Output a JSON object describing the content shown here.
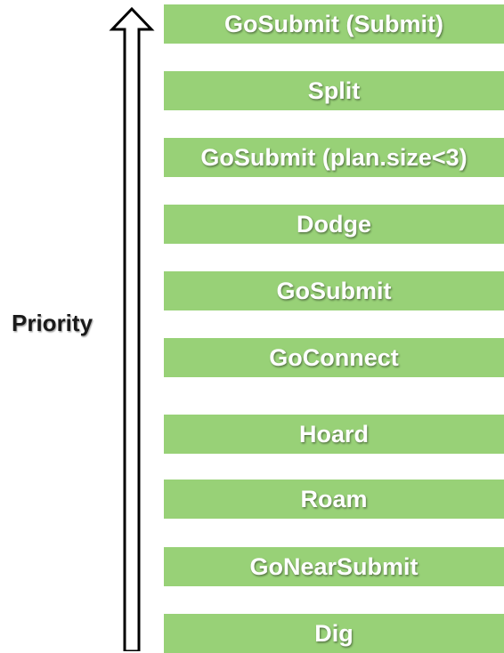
{
  "axis": {
    "label": "Priority"
  },
  "colors": {
    "box_fill": "#98d177",
    "box_text": "#ffffff",
    "arrow_stroke": "#000000"
  },
  "items": [
    {
      "label": "GoSubmit (Submit)"
    },
    {
      "label": "Split"
    },
    {
      "label": "GoSubmit (plan.size<3)"
    },
    {
      "label": "Dodge"
    },
    {
      "label": "GoSubmit"
    },
    {
      "label": "GoConnect"
    },
    {
      "label": "Hoard"
    },
    {
      "label": "Roam"
    },
    {
      "label": "GoNearSubmit"
    },
    {
      "label": "Dig"
    }
  ]
}
